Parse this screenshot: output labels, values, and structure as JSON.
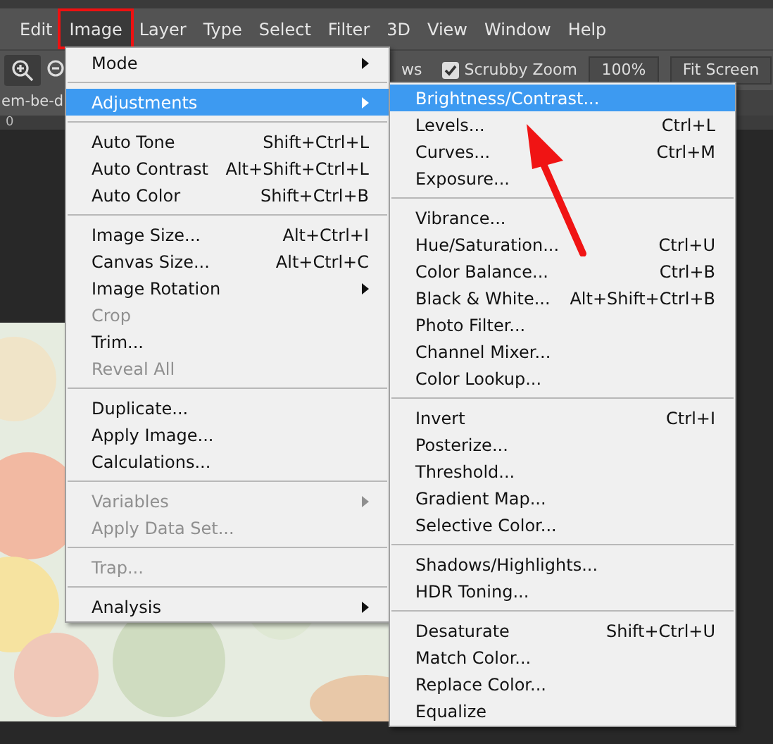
{
  "menu_bar": [
    {
      "label": "Edit",
      "selected": false
    },
    {
      "label": "Image",
      "selected": true
    },
    {
      "label": "Layer",
      "selected": false
    },
    {
      "label": "Type",
      "selected": false
    },
    {
      "label": "Select",
      "selected": false
    },
    {
      "label": "Filter",
      "selected": false
    },
    {
      "label": "3D",
      "selected": false
    },
    {
      "label": "View",
      "selected": false
    },
    {
      "label": "Window",
      "selected": false
    },
    {
      "label": "Help",
      "selected": false
    }
  ],
  "options_bar": {
    "cut_label": "ws",
    "scrubby_zoom": {
      "label": "Scrubby Zoom",
      "checked": true
    },
    "buttons": [
      "100%",
      "Fit Screen"
    ]
  },
  "document_tab": "em-be-d",
  "ruler_label": "0",
  "image_menu": [
    [
      {
        "label": "Mode",
        "submenu": true,
        "disabled": false,
        "selected": false
      }
    ],
    [
      {
        "label": "Adjustments",
        "submenu": true,
        "disabled": false,
        "selected": true
      }
    ],
    [
      {
        "label": "Auto Tone",
        "shortcut": "Shift+Ctrl+L",
        "submenu": false,
        "disabled": false,
        "selected": false
      },
      {
        "label": "Auto Contrast",
        "shortcut": "Alt+Shift+Ctrl+L",
        "submenu": false,
        "disabled": false,
        "selected": false
      },
      {
        "label": "Auto Color",
        "shortcut": "Shift+Ctrl+B",
        "submenu": false,
        "disabled": false,
        "selected": false
      }
    ],
    [
      {
        "label": "Image Size...",
        "shortcut": "Alt+Ctrl+I",
        "submenu": false,
        "disabled": false,
        "selected": false
      },
      {
        "label": "Canvas Size...",
        "shortcut": "Alt+Ctrl+C",
        "submenu": false,
        "disabled": false,
        "selected": false
      },
      {
        "label": "Image Rotation",
        "submenu": true,
        "disabled": false,
        "selected": false
      },
      {
        "label": "Crop",
        "submenu": false,
        "disabled": true,
        "selected": false
      },
      {
        "label": "Trim...",
        "submenu": false,
        "disabled": false,
        "selected": false
      },
      {
        "label": "Reveal All",
        "submenu": false,
        "disabled": true,
        "selected": false
      }
    ],
    [
      {
        "label": "Duplicate...",
        "submenu": false,
        "disabled": false,
        "selected": false
      },
      {
        "label": "Apply Image...",
        "submenu": false,
        "disabled": false,
        "selected": false
      },
      {
        "label": "Calculations...",
        "submenu": false,
        "disabled": false,
        "selected": false
      }
    ],
    [
      {
        "label": "Variables",
        "submenu": true,
        "disabled": true,
        "selected": false
      },
      {
        "label": "Apply Data Set...",
        "submenu": false,
        "disabled": true,
        "selected": false
      }
    ],
    [
      {
        "label": "Trap...",
        "submenu": false,
        "disabled": true,
        "selected": false
      }
    ],
    [
      {
        "label": "Analysis",
        "submenu": true,
        "disabled": false,
        "selected": false
      }
    ]
  ],
  "adjustments_submenu": [
    [
      {
        "label": "Brightness/Contrast...",
        "submenu": false,
        "disabled": false,
        "selected": true
      },
      {
        "label": "Levels...",
        "shortcut": "Ctrl+L",
        "submenu": false,
        "disabled": false,
        "selected": false
      },
      {
        "label": "Curves...",
        "shortcut": "Ctrl+M",
        "submenu": false,
        "disabled": false,
        "selected": false
      },
      {
        "label": "Exposure...",
        "submenu": false,
        "disabled": false,
        "selected": false
      }
    ],
    [
      {
        "label": "Vibrance...",
        "submenu": false,
        "disabled": false,
        "selected": false
      },
      {
        "label": "Hue/Saturation...",
        "shortcut": "Ctrl+U",
        "submenu": false,
        "disabled": false,
        "selected": false
      },
      {
        "label": "Color Balance...",
        "shortcut": "Ctrl+B",
        "submenu": false,
        "disabled": false,
        "selected": false
      },
      {
        "label": "Black & White...",
        "shortcut": "Alt+Shift+Ctrl+B",
        "submenu": false,
        "disabled": false,
        "selected": false
      },
      {
        "label": "Photo Filter...",
        "submenu": false,
        "disabled": false,
        "selected": false
      },
      {
        "label": "Channel Mixer...",
        "submenu": false,
        "disabled": false,
        "selected": false
      },
      {
        "label": "Color Lookup...",
        "submenu": false,
        "disabled": false,
        "selected": false
      }
    ],
    [
      {
        "label": "Invert",
        "shortcut": "Ctrl+I",
        "submenu": false,
        "disabled": false,
        "selected": false
      },
      {
        "label": "Posterize...",
        "submenu": false,
        "disabled": false,
        "selected": false
      },
      {
        "label": "Threshold...",
        "submenu": false,
        "disabled": false,
        "selected": false
      },
      {
        "label": "Gradient Map...",
        "submenu": false,
        "disabled": false,
        "selected": false
      },
      {
        "label": "Selective Color...",
        "submenu": false,
        "disabled": false,
        "selected": false
      }
    ],
    [
      {
        "label": "Shadows/Highlights...",
        "submenu": false,
        "disabled": false,
        "selected": false
      },
      {
        "label": "HDR Toning...",
        "submenu": false,
        "disabled": false,
        "selected": false
      }
    ],
    [
      {
        "label": "Desaturate",
        "shortcut": "Shift+Ctrl+U",
        "submenu": false,
        "disabled": false,
        "selected": false
      },
      {
        "label": "Match Color...",
        "submenu": false,
        "disabled": false,
        "selected": false
      },
      {
        "label": "Replace Color...",
        "submenu": false,
        "disabled": false,
        "selected": false
      },
      {
        "label": "Equalize",
        "submenu": false,
        "disabled": false,
        "selected": false
      }
    ]
  ]
}
